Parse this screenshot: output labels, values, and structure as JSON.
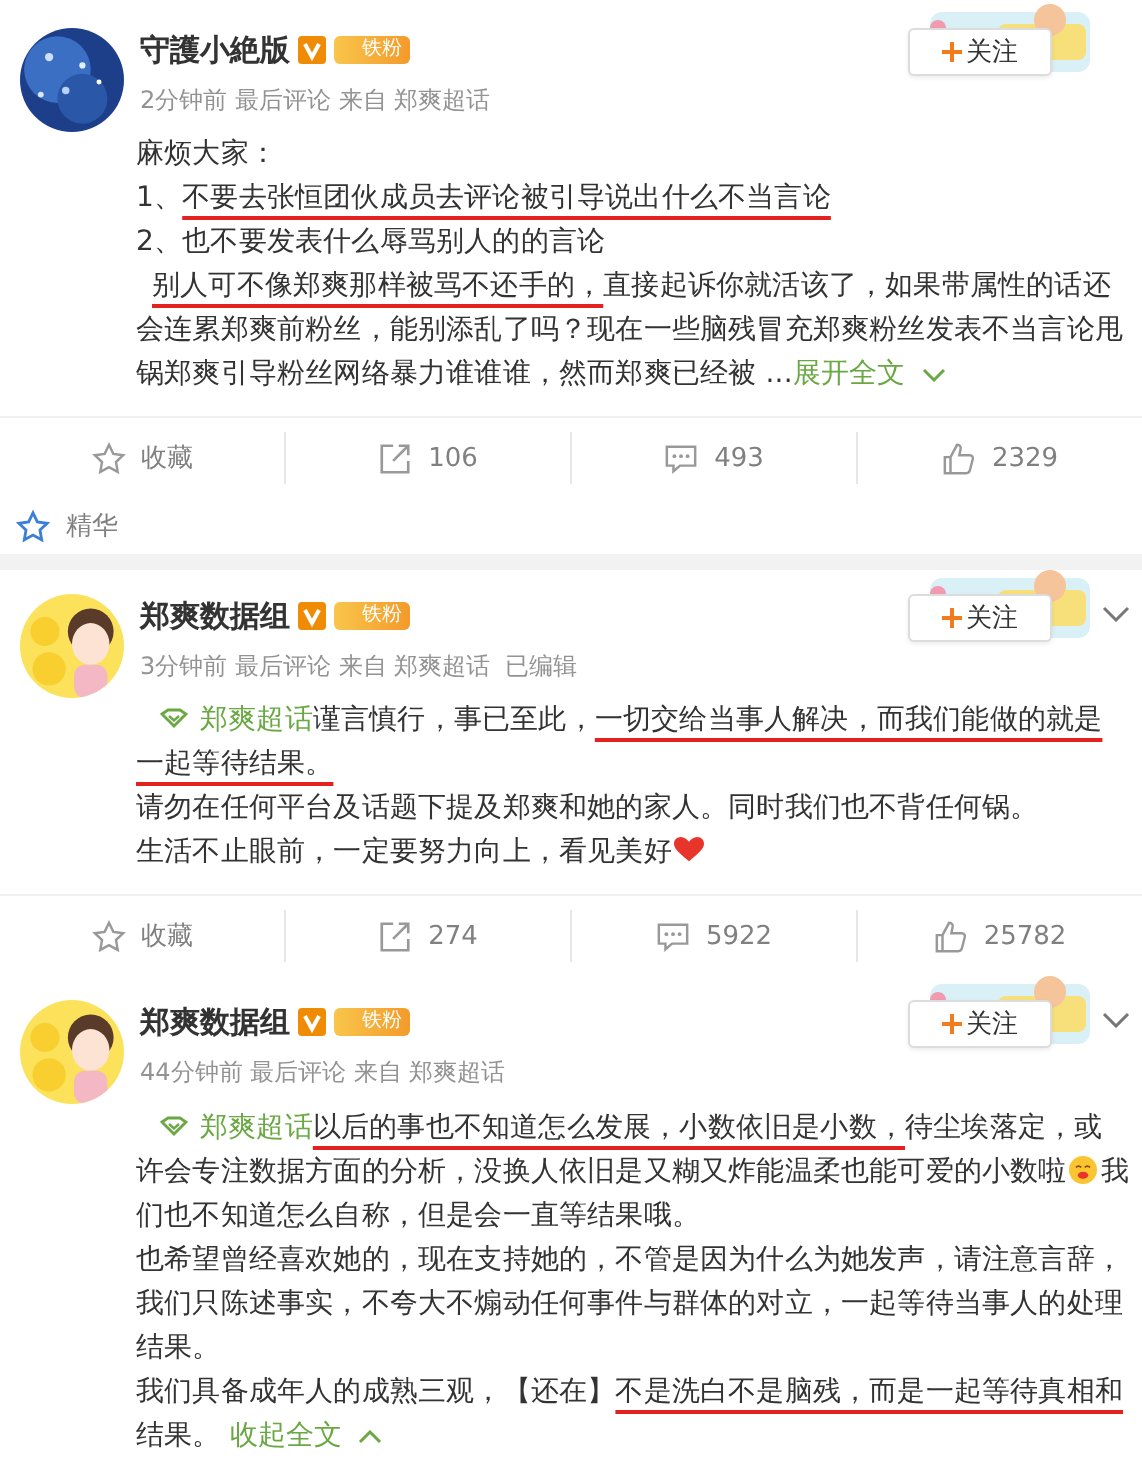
{
  "posts": [
    {
      "avatar": {
        "kind": "picture"
      },
      "decoration": {
        "kind": "picture"
      },
      "name": "守護小絶版",
      "badge": "铁粉",
      "meta": "2分钟前 最后评论 来自 郑爽超话",
      "follow": "关注",
      "menu": false,
      "paragraphs": [
        [
          {
            "kind": "text",
            "text": "麻烦大家："
          }
        ],
        [
          {
            "kind": "text",
            "text": "1、"
          },
          {
            "kind": "underline",
            "text": "不要去张恒团伙成员去评论被引导说出什么不当言论"
          }
        ],
        [
          {
            "kind": "text",
            "text": "2、也不要发表什么辱骂别人的的言论"
          }
        ],
        [
          {
            "kind": "indent"
          },
          {
            "kind": "underline",
            "text": "别人可不像郑爽那样被骂不还手的，"
          },
          {
            "kind": "text",
            "text": "直接起诉你就活该了，如果带属性的话还会连累郑爽前粉丝，能别添乱了吗？现在一些脑残冒充郑爽粉丝发表不当言论甩锅郑爽引导粉丝网络暴力谁谁谁，然而郑爽已经被 ..."
          },
          {
            "kind": "more",
            "text": "展开全文",
            "expanded": false
          }
        ]
      ],
      "actions": [
        {
          "kind": "favorite",
          "text": "收藏"
        },
        {
          "kind": "share",
          "text": "106"
        },
        {
          "kind": "comment",
          "text": "493"
        },
        {
          "kind": "like",
          "text": "2329"
        }
      ],
      "highlight": "精华"
    },
    {
      "avatar": {
        "kind": "picture"
      },
      "decoration": {
        "kind": "picture"
      },
      "name": "郑爽数据组",
      "badge": "铁粉",
      "meta": "3分钟前 最后评论 来自 郑爽超话  已编辑",
      "follow": "关注",
      "menu": true,
      "paragraphs": [
        [
          {
            "kind": "topic",
            "text": "郑爽超话"
          },
          {
            "kind": "text",
            "text": "谨言慎行，事已至此，"
          },
          {
            "kind": "underline",
            "text": "一切交给当事人解决，而我们能做的就是一起等待结果。"
          }
        ],
        [
          {
            "kind": "text",
            "text": "请勿在任何平台及话题下提及郑爽和她的家人。同时我们也不背任何锅。"
          }
        ],
        [
          {
            "kind": "text",
            "text": "生活不止眼前，一定要努力向上，看见美好"
          },
          {
            "kind": "heart"
          }
        ]
      ],
      "actions": [
        {
          "kind": "favorite",
          "text": "收藏"
        },
        {
          "kind": "share",
          "text": "274"
        },
        {
          "kind": "comment",
          "text": "5922"
        },
        {
          "kind": "like",
          "text": "25782"
        }
      ]
    },
    {
      "avatar": {
        "kind": "picture"
      },
      "decoration": {
        "kind": "picture"
      },
      "name": "郑爽数据组",
      "badge": "铁粉",
      "meta": "44分钟前 最后评论 来自 郑爽超话",
      "follow": "关注",
      "menu": true,
      "paragraphs": [
        [
          {
            "kind": "topic",
            "text": "郑爽超话"
          },
          {
            "kind": "underline",
            "text": "以后的事也不知道怎么发展，小数依旧是小数，"
          },
          {
            "kind": "text",
            "text": "待尘埃落定，或许会专注数据方面的分析，没换人依旧是又糊又炸能温柔也能可爱的小数啦"
          },
          {
            "kind": "emoji"
          },
          {
            "kind": "text",
            "text": "我们也不知道怎么自称，但是会一直等结果哦。"
          }
        ],
        [
          {
            "kind": "text",
            "text": "也希望曾经喜欢她的，现在支持她的，不管是因为什么为她发声，请注意言辞，我们只陈述事实，不夸大不煽动任何事件与群体的对立，一起等待当事人的处理结果。"
          }
        ],
        [
          {
            "kind": "text",
            "text": "我们具备成年人的成熟三观，【还在】"
          },
          {
            "kind": "underline",
            "text": "不是洗白不是脑残，而是一起等待真相和"
          },
          {
            "kind": "text",
            "text": "结果。 "
          },
          {
            "kind": "more",
            "text": "收起全文",
            "expanded": true
          }
        ]
      ]
    }
  ]
}
